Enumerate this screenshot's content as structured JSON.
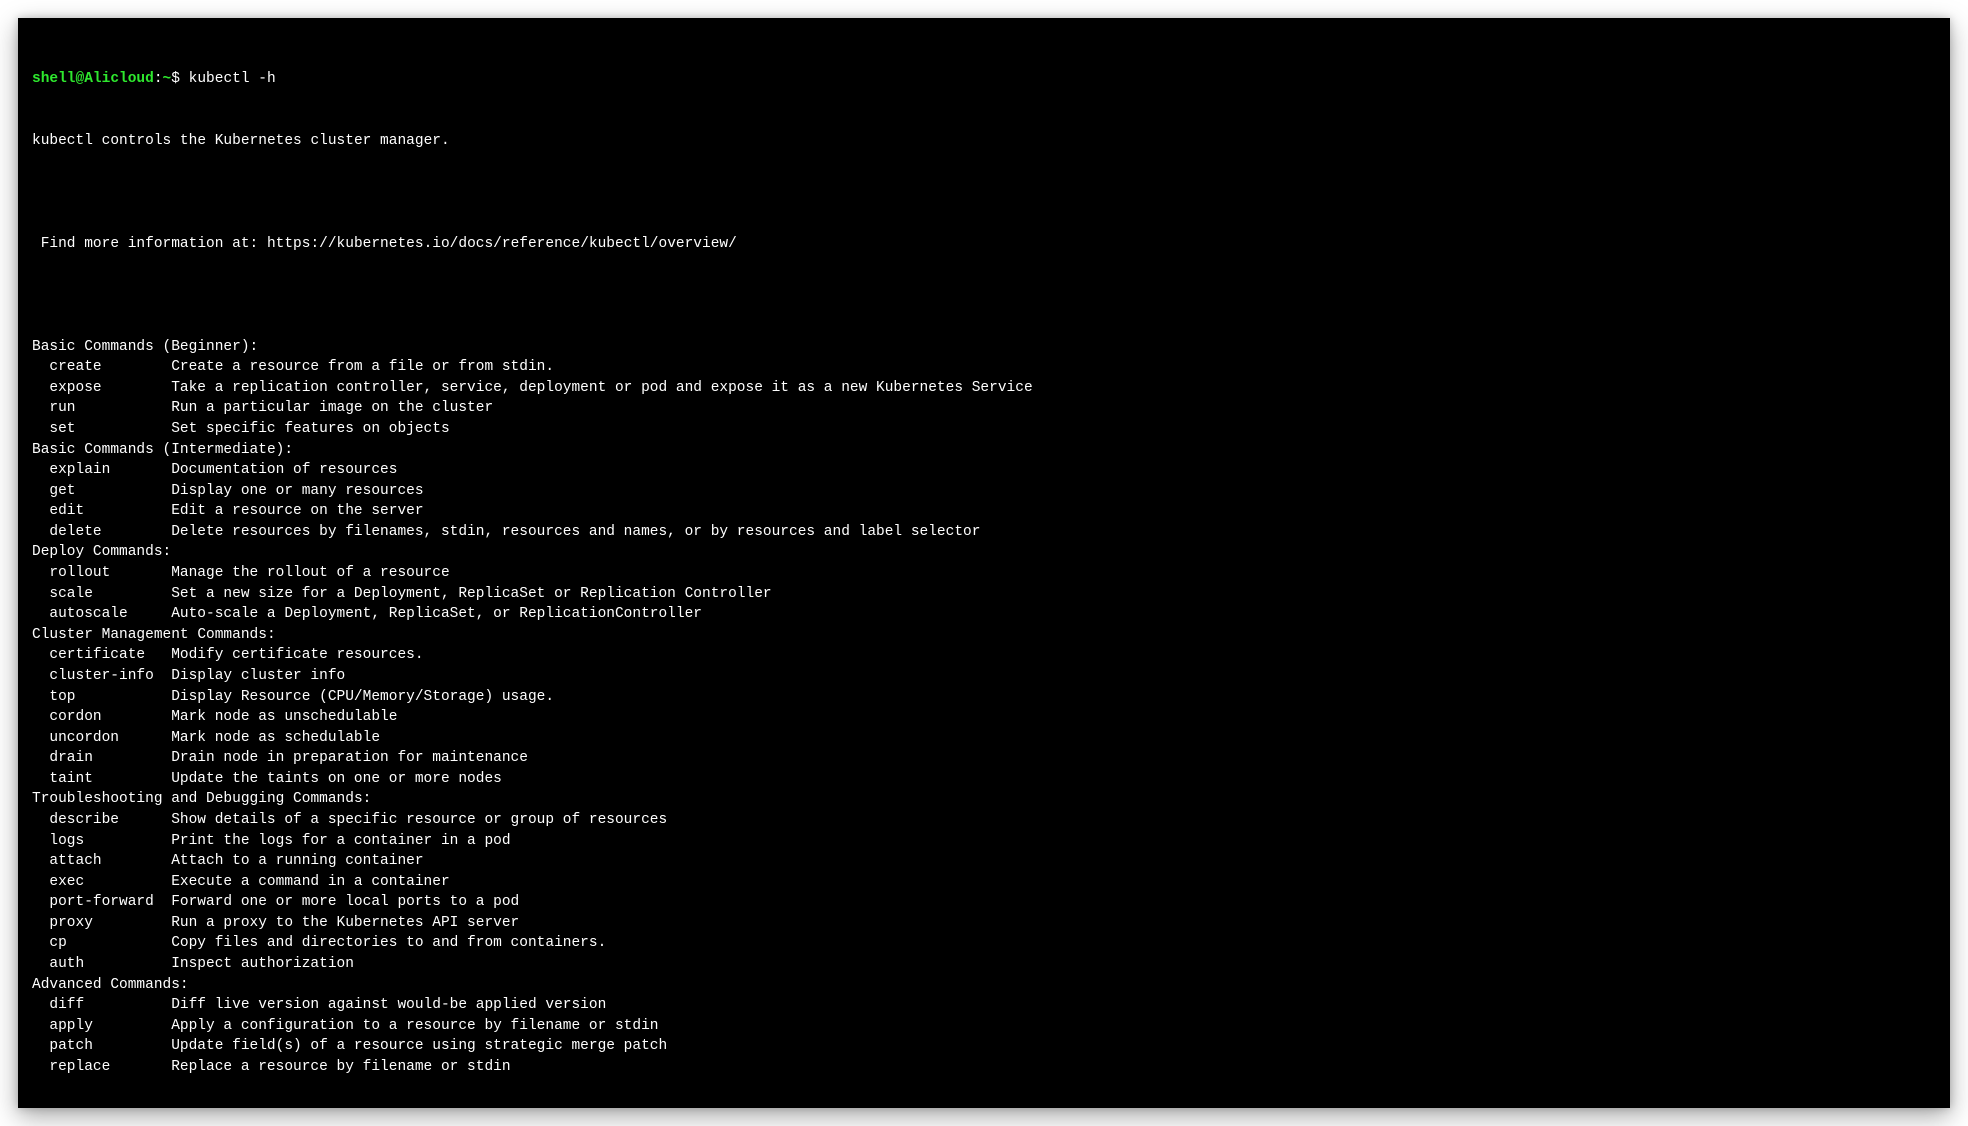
{
  "prompt": {
    "user_host": "shell@Alicloud",
    "sep": ":",
    "path": "~",
    "dollar": "$ ",
    "command": "kubectl -h"
  },
  "intro": {
    "line1": "kubectl controls the Kubernetes cluster manager.",
    "blank1": "",
    "line2": " Find more information at: https://kubernetes.io/docs/reference/kubectl/overview/",
    "blank2": ""
  },
  "sections": [
    {
      "title": "Basic Commands (Beginner):",
      "items": [
        {
          "name": "create",
          "desc": "Create a resource from a file or from stdin."
        },
        {
          "name": "expose",
          "desc": "Take a replication controller, service, deployment or pod and expose it as a new Kubernetes Service"
        },
        {
          "name": "run",
          "desc": "Run a particular image on the cluster"
        },
        {
          "name": "set",
          "desc": "Set specific features on objects"
        }
      ]
    },
    {
      "title": "Basic Commands (Intermediate):",
      "items": [
        {
          "name": "explain",
          "desc": "Documentation of resources"
        },
        {
          "name": "get",
          "desc": "Display one or many resources"
        },
        {
          "name": "edit",
          "desc": "Edit a resource on the server"
        },
        {
          "name": "delete",
          "desc": "Delete resources by filenames, stdin, resources and names, or by resources and label selector"
        }
      ]
    },
    {
      "title": "Deploy Commands:",
      "items": [
        {
          "name": "rollout",
          "desc": "Manage the rollout of a resource"
        },
        {
          "name": "scale",
          "desc": "Set a new size for a Deployment, ReplicaSet or Replication Controller"
        },
        {
          "name": "autoscale",
          "desc": "Auto-scale a Deployment, ReplicaSet, or ReplicationController"
        }
      ]
    },
    {
      "title": "Cluster Management Commands:",
      "items": [
        {
          "name": "certificate",
          "desc": "Modify certificate resources."
        },
        {
          "name": "cluster-info",
          "desc": "Display cluster info"
        },
        {
          "name": "top",
          "desc": "Display Resource (CPU/Memory/Storage) usage."
        },
        {
          "name": "cordon",
          "desc": "Mark node as unschedulable"
        },
        {
          "name": "uncordon",
          "desc": "Mark node as schedulable"
        },
        {
          "name": "drain",
          "desc": "Drain node in preparation for maintenance"
        },
        {
          "name": "taint",
          "desc": "Update the taints on one or more nodes"
        }
      ]
    },
    {
      "title": "Troubleshooting and Debugging Commands:",
      "items": [
        {
          "name": "describe",
          "desc": "Show details of a specific resource or group of resources"
        },
        {
          "name": "logs",
          "desc": "Print the logs for a container in a pod"
        },
        {
          "name": "attach",
          "desc": "Attach to a running container"
        },
        {
          "name": "exec",
          "desc": "Execute a command in a container"
        },
        {
          "name": "port-forward",
          "desc": "Forward one or more local ports to a pod"
        },
        {
          "name": "proxy",
          "desc": "Run a proxy to the Kubernetes API server"
        },
        {
          "name": "cp",
          "desc": "Copy files and directories to and from containers."
        },
        {
          "name": "auth",
          "desc": "Inspect authorization"
        }
      ]
    },
    {
      "title": "Advanced Commands:",
      "items": [
        {
          "name": "diff",
          "desc": "Diff live version against would-be applied version"
        },
        {
          "name": "apply",
          "desc": "Apply a configuration to a resource by filename or stdin"
        },
        {
          "name": "patch",
          "desc": "Update field(s) of a resource using strategic merge patch"
        },
        {
          "name": "replace",
          "desc": "Replace a resource by filename or stdin"
        }
      ]
    }
  ]
}
